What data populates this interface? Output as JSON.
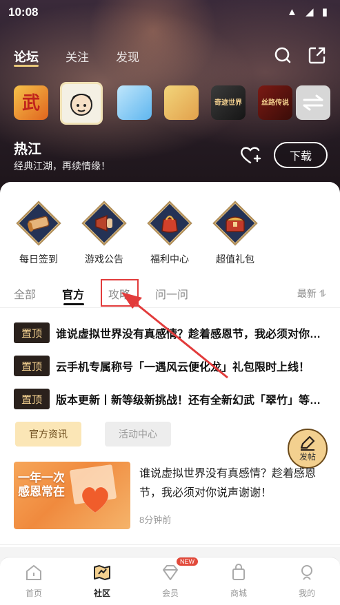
{
  "status_bar": {
    "time": "10:08",
    "icons": "▲ ◢ ▮"
  },
  "top_nav": {
    "tabs": [
      {
        "label": "论坛"
      },
      {
        "label": "关注"
      },
      {
        "label": "发现"
      }
    ]
  },
  "games": [
    {
      "label": "武"
    },
    {
      "label": ""
    },
    {
      "label": ""
    },
    {
      "label": ""
    },
    {
      "label": "奇迹世界"
    },
    {
      "label": "丝路传说"
    }
  ],
  "game": {
    "title": "热江",
    "subtitle": "经典江湖，再续情缘！",
    "download_label": "下载"
  },
  "features": [
    {
      "label": "每日签到",
      "icon": "scroll-icon"
    },
    {
      "label": "游戏公告",
      "icon": "megaphone-icon"
    },
    {
      "label": "福利中心",
      "icon": "gift-bag-icon"
    },
    {
      "label": "超值礼包",
      "icon": "treasure-chest-icon"
    }
  ],
  "tabs": [
    {
      "label": "全部"
    },
    {
      "label": "官方"
    },
    {
      "label": "攻略"
    },
    {
      "label": "问一问"
    }
  ],
  "sort_label": "最新 ⥮",
  "pinned": {
    "badge": "置顶",
    "items": [
      "谁说虚拟世界没有真感情？趁着感恩节，我必须对你说声谢谢！",
      "云手机专属称号「一遇风云便化龙」礼包限时上线！",
      "版本更新丨新等级新挑战！还有全新幻武「翠竹」等你来拿！"
    ]
  },
  "chips": {
    "active": "官方资讯",
    "inactive": "活动中心"
  },
  "fab": {
    "label": "发帖"
  },
  "article": {
    "thumb_text_1": "一年一次",
    "thumb_text_2": "感恩常在",
    "title": "谁说虚拟世界没有真感情？趁着感恩节，我必须对你说声谢谢！",
    "time": "8分钟前"
  },
  "bottom_nav": {
    "items": [
      {
        "label": "首页"
      },
      {
        "label": "社区"
      },
      {
        "label": "会员"
      },
      {
        "label": "商城"
      },
      {
        "label": "我的"
      }
    ],
    "new_badge": "NEW"
  },
  "colors": {
    "accent_gold": "#e8c77a",
    "pin_bg": "#2a211c",
    "pin_text": "#f3d08f",
    "annotation_red": "#e23b3b"
  }
}
